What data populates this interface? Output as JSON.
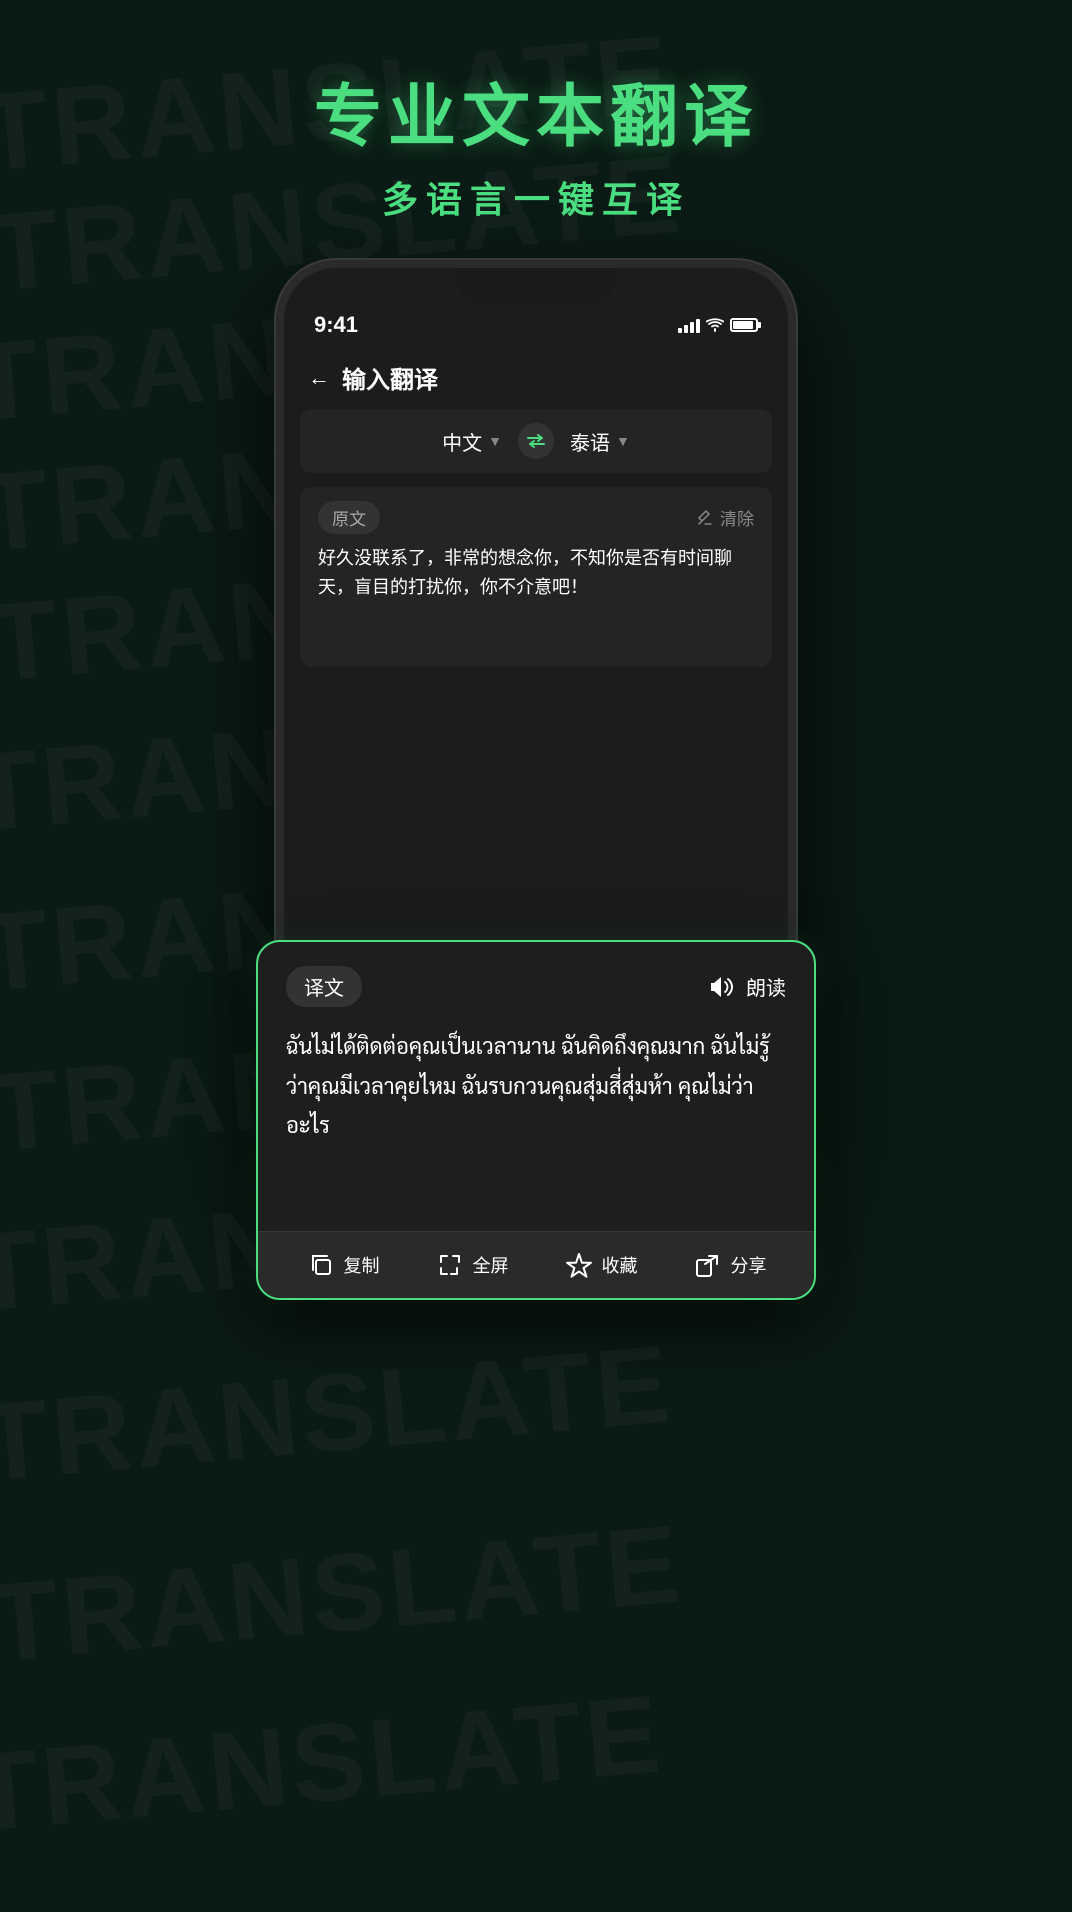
{
  "background": {
    "color": "#0a1a14",
    "watermark_text": "TRANSLATE"
  },
  "header": {
    "title_main": "专业文本翻译",
    "title_sub": "多语言一键互译"
  },
  "phone": {
    "status_bar": {
      "time": "9:41"
    },
    "app_header": {
      "back_label": "←",
      "title": "输入翻译"
    },
    "language_bar": {
      "source_lang": "中文",
      "target_lang": "泰语"
    },
    "input_area": {
      "label": "原文",
      "clear_label": "清除",
      "text": "好久没联系了，非常的想念你，不知你是否有时间聊天，盲目的打扰你，你不介意吧！"
    }
  },
  "translation_card": {
    "badge_label": "译文",
    "read_aloud_label": "朗读",
    "translated_text": "ฉันไม่ได้ติดต่อคุณเป็นเวลานาน ฉันคิดถึงคุณมาก ฉันไม่รู้ว่าคุณมีเวลาคุยไหม ฉันรบกวนคุณสุ่มสี่สุ่มห้า คุณไม่ว่าอะไร",
    "actions": [
      {
        "icon": "copy-icon",
        "label": "复制"
      },
      {
        "icon": "fullscreen-icon",
        "label": "全屏"
      },
      {
        "icon": "star-icon",
        "label": "收藏"
      },
      {
        "icon": "share-icon",
        "label": "分享"
      }
    ]
  },
  "watermark": {
    "text": "TRANSLATE"
  }
}
